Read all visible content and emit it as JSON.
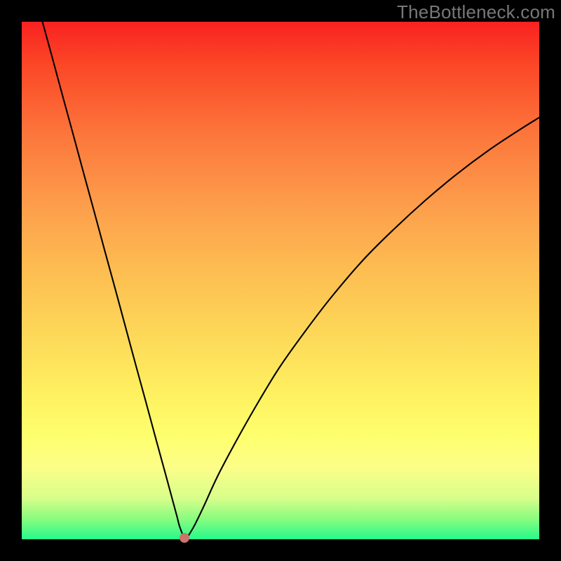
{
  "watermark": "TheBottleneck.com",
  "colors": {
    "background": "#000000",
    "gradient_top": "#fa2121",
    "gradient_bottom": "#27fa8b",
    "curve": "#000000",
    "marker": "#c9756a"
  },
  "chart_data": {
    "type": "line",
    "title": "",
    "xlabel": "",
    "ylabel": "",
    "xlim": [
      0,
      100
    ],
    "ylim": [
      0,
      100
    ],
    "series": [
      {
        "name": "bottleneck-curve",
        "x": [
          4,
          6,
          8,
          10,
          12,
          14,
          16,
          18,
          20,
          22,
          24,
          26,
          28,
          29,
          30,
          30.6,
          31.6,
          33,
          35,
          38,
          42,
          46,
          50,
          55,
          60,
          66,
          72,
          78,
          84,
          90,
          96,
          100
        ],
        "y": [
          100,
          92.7,
          85.3,
          78,
          70.6,
          63.3,
          55.9,
          48.6,
          41.2,
          33.8,
          26.5,
          19.1,
          11.8,
          8.1,
          4.4,
          2.2,
          0.3,
          2,
          6,
          12.5,
          20,
          27,
          33.5,
          40.5,
          47,
          54,
          60,
          65.5,
          70.5,
          75,
          79,
          81.5
        ]
      }
    ],
    "marker": {
      "x": 31.5,
      "y": 0.3
    },
    "annotations": []
  }
}
